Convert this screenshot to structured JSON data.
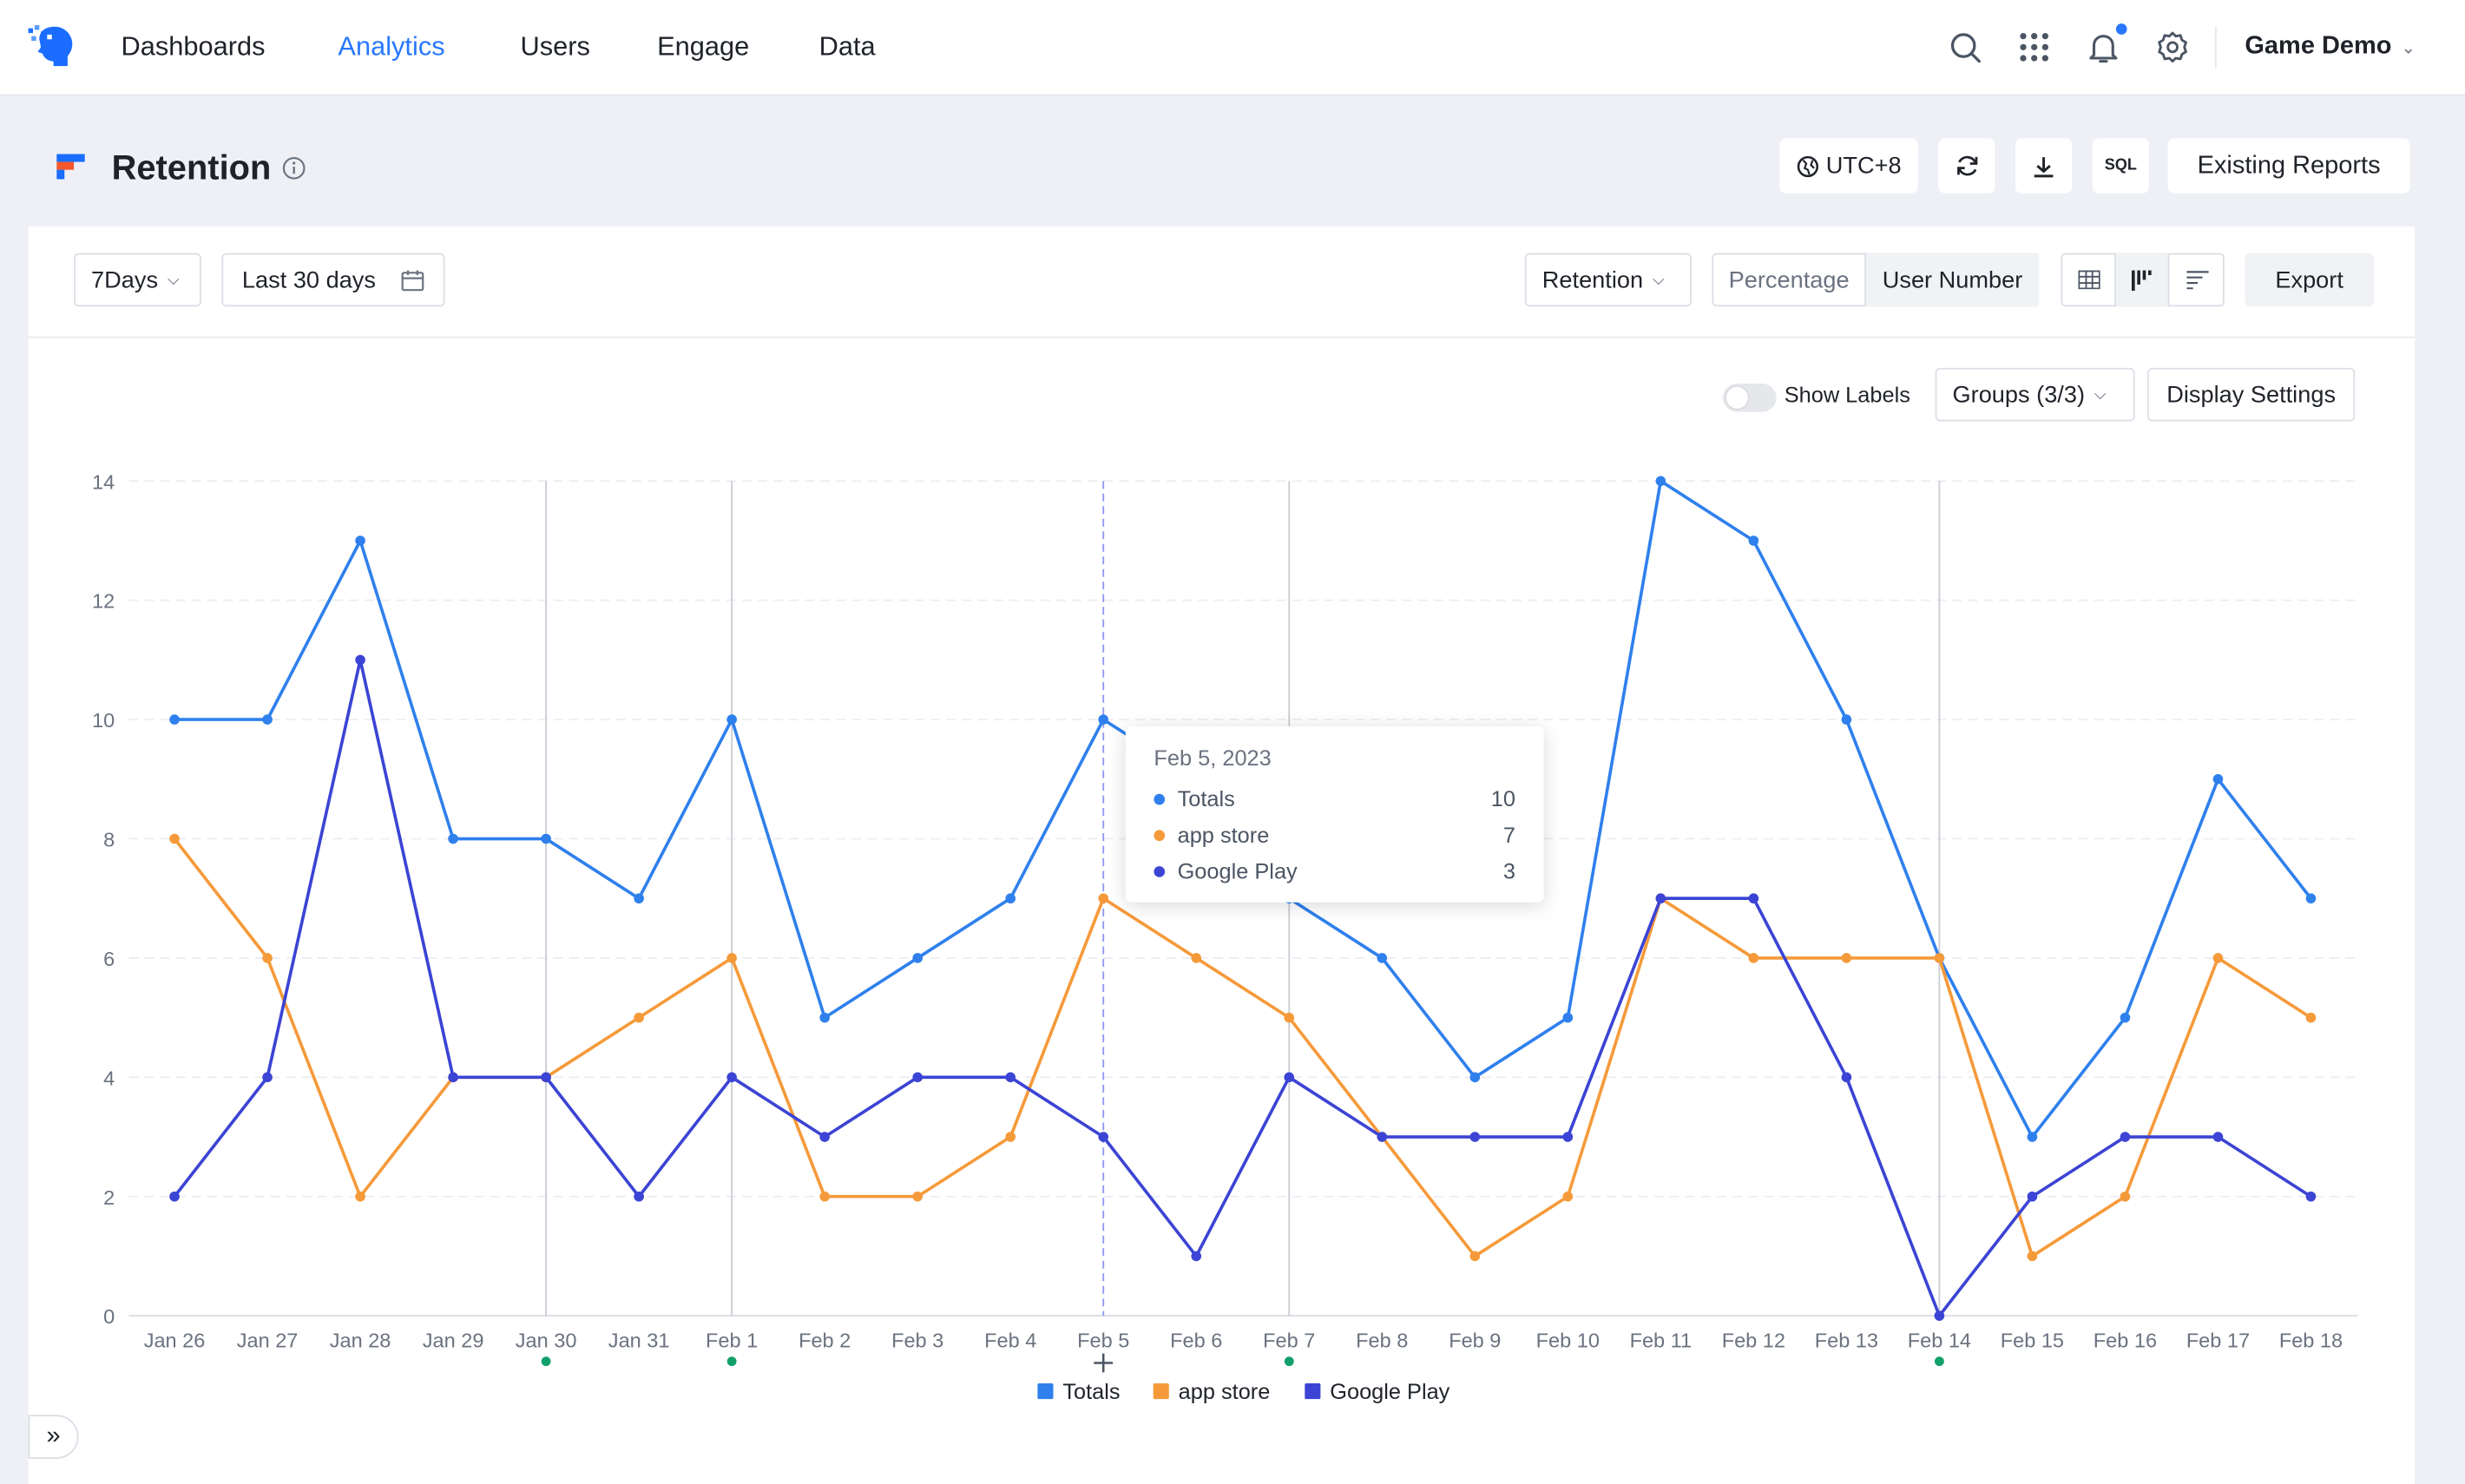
{
  "nav": {
    "items": [
      "Dashboards",
      "Analytics",
      "Users",
      "Engage",
      "Data"
    ],
    "active": "Analytics",
    "project": "Game Demo",
    "icons": [
      "search-icon",
      "apps-grid-icon",
      "bell-icon",
      "gear-icon"
    ]
  },
  "page": {
    "title": "Retention",
    "timezone": "UTC+8",
    "sql_label": "SQL",
    "existing_reports": "Existing Reports"
  },
  "filters": {
    "period": "7Days",
    "date_range": "Last 30 days",
    "metric": "Retention",
    "mode_options": [
      "Percentage",
      "User Number"
    ],
    "mode_selected": "User Number",
    "export": "Export"
  },
  "chart_controls": {
    "show_labels": "Show Labels",
    "groups": "Groups (3/3)",
    "display_settings": "Display Settings"
  },
  "colors": {
    "accent": "#2878ff",
    "totals": "#2f80ed",
    "app_store": "#f59a3a",
    "google_play": "#3b44d4",
    "marker": "#12a06a"
  },
  "chart_data": {
    "type": "line",
    "categories": [
      "Jan 26",
      "Jan 27",
      "Jan 28",
      "Jan 29",
      "Jan 30",
      "Jan 31",
      "Feb 1",
      "Feb 2",
      "Feb 3",
      "Feb 4",
      "Feb 5",
      "Feb 6",
      "Feb 7",
      "Feb 8",
      "Feb 9",
      "Feb 10",
      "Feb 11",
      "Feb 12",
      "Feb 13",
      "Feb 14",
      "Feb 15",
      "Feb 16",
      "Feb 17",
      "Feb 18"
    ],
    "series": [
      {
        "name": "Totals",
        "values": [
          10,
          10,
          13,
          8,
          8,
          7,
          10,
          5,
          6,
          7,
          10,
          9,
          7,
          6,
          4,
          5,
          14,
          13,
          10,
          6,
          3,
          5,
          9,
          7
        ]
      },
      {
        "name": "app store",
        "values": [
          8,
          6,
          2,
          4,
          4,
          5,
          6,
          2,
          2,
          3,
          7,
          6,
          5,
          3,
          1,
          2,
          7,
          6,
          6,
          6,
          1,
          2,
          6,
          5
        ]
      },
      {
        "name": "Google Play",
        "values": [
          2,
          4,
          11,
          4,
          4,
          2,
          4,
          3,
          4,
          4,
          3,
          1,
          4,
          3,
          3,
          3,
          7,
          7,
          4,
          0,
          2,
          3,
          3,
          2
        ]
      }
    ],
    "ylim": [
      0,
      14
    ],
    "yticks": [
      0,
      2,
      4,
      6,
      8,
      10,
      12,
      14
    ],
    "marked_dates": [
      "Jan 30",
      "Feb 1",
      "Feb 7",
      "Feb 14"
    ],
    "hover_date": "Feb 5",
    "grid": "horizontal dashed",
    "legend": "bottom-center"
  },
  "tooltip": {
    "date": "Feb 5, 2023",
    "rows": [
      {
        "name": "Totals",
        "value": "10"
      },
      {
        "name": "app store",
        "value": "7"
      },
      {
        "name": "Google Play",
        "value": "3"
      }
    ]
  }
}
